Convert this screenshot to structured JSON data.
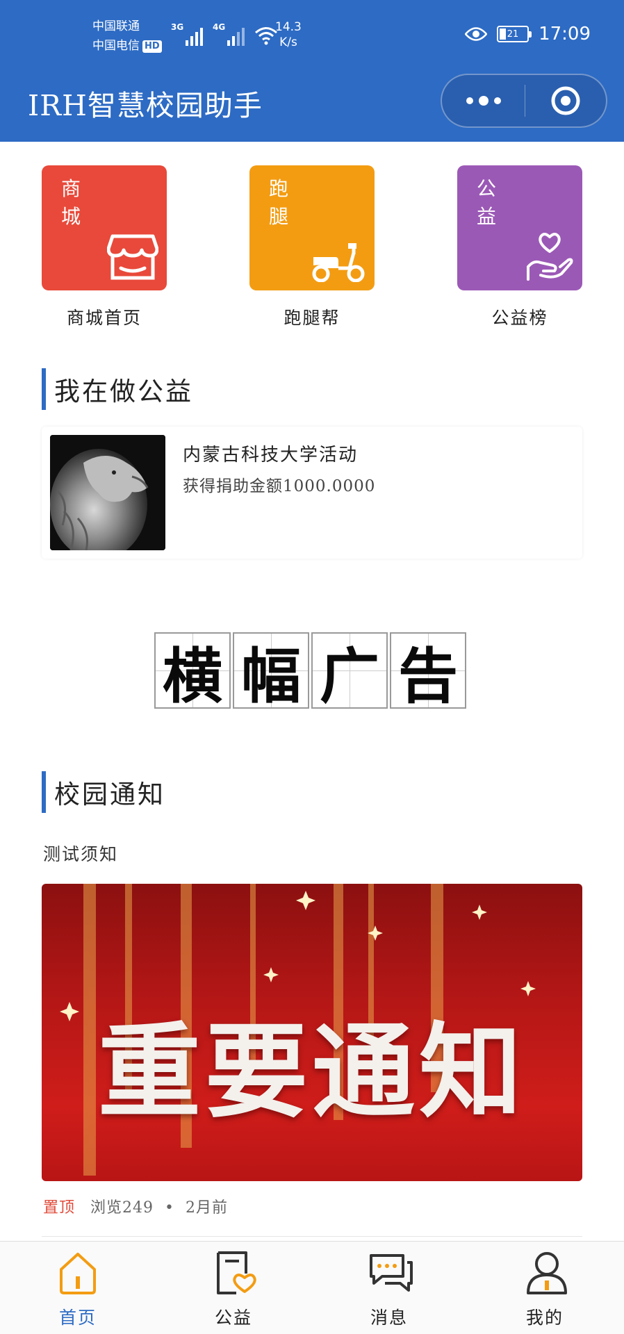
{
  "status_bar": {
    "carrier_1": "中国联通",
    "carrier_2": "中国电信",
    "hd_badge": "HD",
    "signal_1_tag": "3G",
    "signal_2_tag": "4G",
    "net_speed_value": "14.3",
    "net_speed_unit": "K/s",
    "battery_level": "21",
    "time": "17:09"
  },
  "header": {
    "title": "IRH智慧校园助手",
    "accent_color": "#2d6bc4"
  },
  "categories": [
    {
      "tile_text_1": "商",
      "tile_text_2": "城",
      "caption": "商城首页",
      "icon": "storefront-icon",
      "color": "#e8493a"
    },
    {
      "tile_text_1": "跑",
      "tile_text_2": "腿",
      "caption": "跑腿帮",
      "icon": "scooter-icon",
      "color": "#f39c12"
    },
    {
      "tile_text_1": "公",
      "tile_text_2": "益",
      "caption": "公益榜",
      "icon": "heart-in-hand-icon",
      "color": "#9b59b6"
    }
  ],
  "charity_section": {
    "heading": "我在做公益",
    "item": {
      "name": "内蒙古科技大学活动",
      "amount_text": "获得捐助金额1000.0000"
    }
  },
  "banner_ad": {
    "chars": [
      "横",
      "幅",
      "广",
      "告"
    ]
  },
  "notice_section": {
    "heading": "校园通知",
    "subject": "测试须知",
    "image_headline": "重要通知",
    "pinned_label": "置顶",
    "views_text": "浏览249",
    "separator": "•",
    "time_ago": "2月前"
  },
  "tabbar": {
    "active_color": "#2d6bc4",
    "items": [
      {
        "label": "首页",
        "icon": "home-icon",
        "active": true
      },
      {
        "label": "公益",
        "icon": "charity-icon",
        "active": false
      },
      {
        "label": "消息",
        "icon": "message-icon",
        "active": false
      },
      {
        "label": "我的",
        "icon": "profile-icon",
        "active": false
      }
    ]
  }
}
